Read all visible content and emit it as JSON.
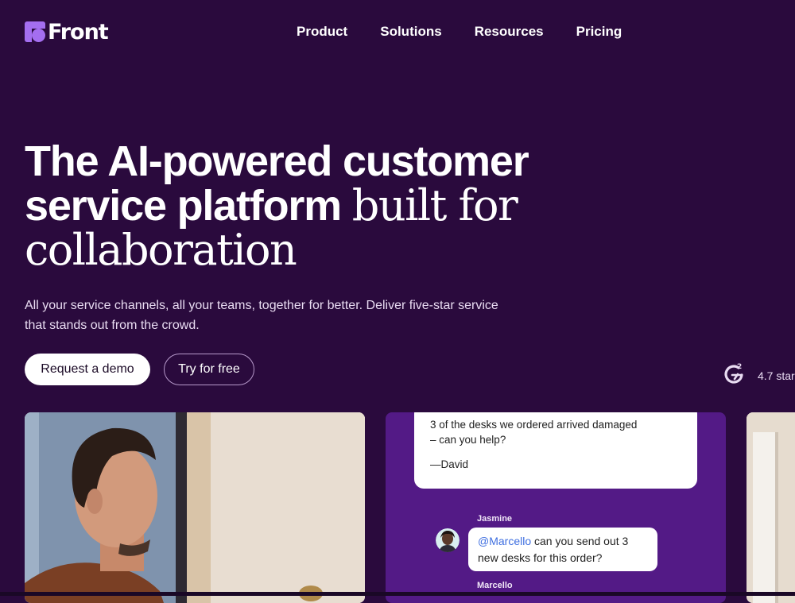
{
  "brand": {
    "name": "Front"
  },
  "nav": {
    "items": [
      "Product",
      "Solutions",
      "Resources",
      "Pricing"
    ]
  },
  "hero": {
    "title_line1": "The AI-powered customer",
    "title_line2_sans": "service platform",
    "title_line2_serif": "built for",
    "title_line3": "collaboration",
    "subtitle_line1": "All your service channels, all your teams, together for better. Deliver five-star service",
    "subtitle_line2": "that stands out from the crowd.",
    "cta_primary": "Request a demo",
    "cta_secondary": "Try for free"
  },
  "rating": {
    "badge": "G2",
    "text": "4.7 star"
  },
  "chat_card": {
    "message_line1": "3 of the desks we ordered arrived damaged",
    "message_line2": "– can you help?",
    "message_signature": "—David",
    "reply_author": "Jasmine",
    "reply_mention": "@Marcello",
    "reply_text_a": " can you send out 3",
    "reply_text_b": "new desks for this order?",
    "next_author": "Marcello"
  },
  "colors": {
    "background": "#2a0a3d",
    "brand_accent": "#a46ef0",
    "chat_card": "#531a86",
    "mention": "#3f6fe0"
  },
  "icons": {
    "logo": "front-logo-icon",
    "rating": "g2-icon"
  }
}
